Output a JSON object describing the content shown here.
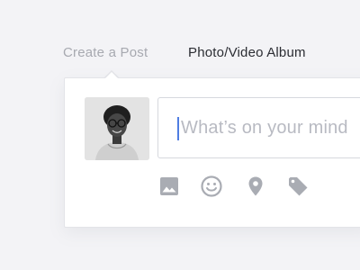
{
  "tabs": {
    "create_post": "Create a Post",
    "photo_video_album": "Photo/Video Album"
  },
  "composer": {
    "placeholder": "What’s on your mind"
  },
  "actions": {
    "photo_icon": "image-icon",
    "emoji_icon": "smiley-icon",
    "location_icon": "map-pin-icon",
    "tag_icon": "tag-icon"
  },
  "colors": {
    "background": "#f3f3f6",
    "card": "#ffffff",
    "icon": "#a9acb3",
    "cursor": "#4f7de2",
    "tab_inactive": "#a7a9b0",
    "tab_active": "#2b2d33"
  }
}
